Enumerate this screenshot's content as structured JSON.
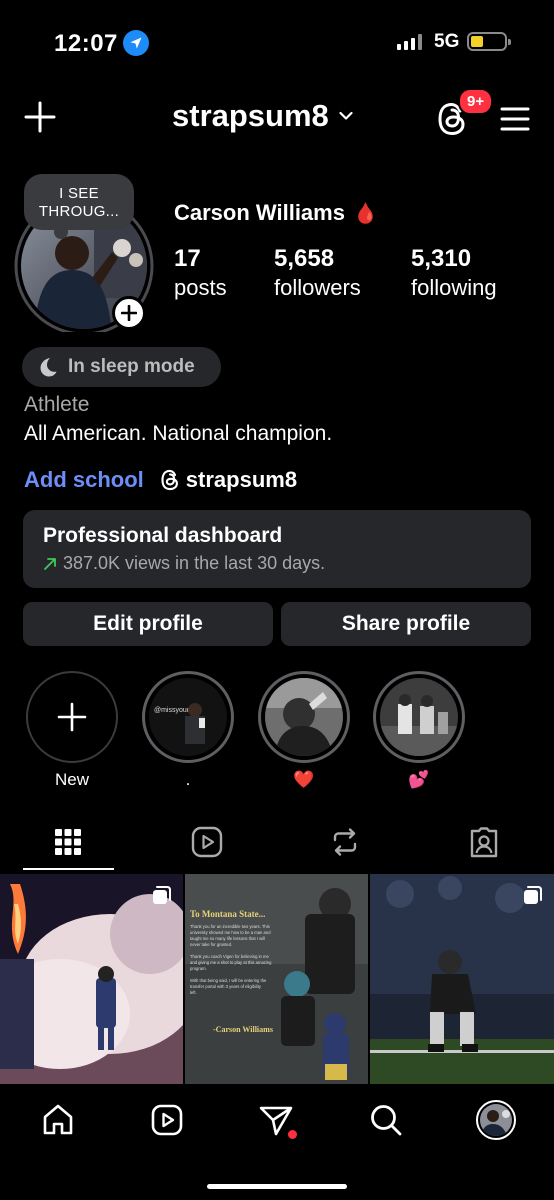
{
  "status_bar": {
    "time": "12:07",
    "network": "5G"
  },
  "header": {
    "username": "strapsum8",
    "notification_badge": "9+"
  },
  "profile": {
    "note": "I SEE THROUG...",
    "name": "Carson Williams",
    "name_emoji": "🩸",
    "stats": [
      {
        "value": "17",
        "label": "posts"
      },
      {
        "value": "5,658",
        "label": "followers"
      },
      {
        "value": "5,310",
        "label": "following"
      }
    ],
    "sleep_mode": "In sleep mode",
    "category": "Athlete",
    "bio": "All American. National champion.",
    "add_school": "Add school",
    "threads_handle": "strapsum8"
  },
  "dashboard": {
    "title": "Professional dashboard",
    "subtitle": "387.0K views in the last 30 days."
  },
  "buttons": {
    "edit": "Edit profile",
    "share": "Share profile"
  },
  "highlights": [
    {
      "label": "New"
    },
    {
      "label": "."
    },
    {
      "label": "❤️"
    },
    {
      "label": "💕"
    }
  ],
  "highlight_texts": {
    "missyoudad": "@missyoudad"
  },
  "post_2": {
    "heading": "To Montana State...",
    "paragraphs": [
      "Thank you for an incredible two years. This university showed me how to be a man and taught me so many life lessons that I will never take for granted.",
      "Thank you coach Vigen for believing in me and giving me a shot to play at this amazing program.",
      "With that being said, I will be entering the transfer portal with 3 years of eligibility left."
    ],
    "signature": "-Carson Williams"
  },
  "colors": {
    "background": "#000000",
    "surface": "#26272b",
    "link_blue": "#6e8ef7",
    "badge_red": "#ff3040",
    "trend_green": "#3fc85c",
    "location_blue": "#1d8cf8"
  },
  "icons": {
    "tabs": [
      "grid-icon",
      "reels-icon",
      "reposts-icon",
      "tagged-icon"
    ],
    "nav": [
      "home-icon",
      "reels-icon",
      "direct-icon",
      "search-icon",
      "profile-avatar"
    ]
  }
}
